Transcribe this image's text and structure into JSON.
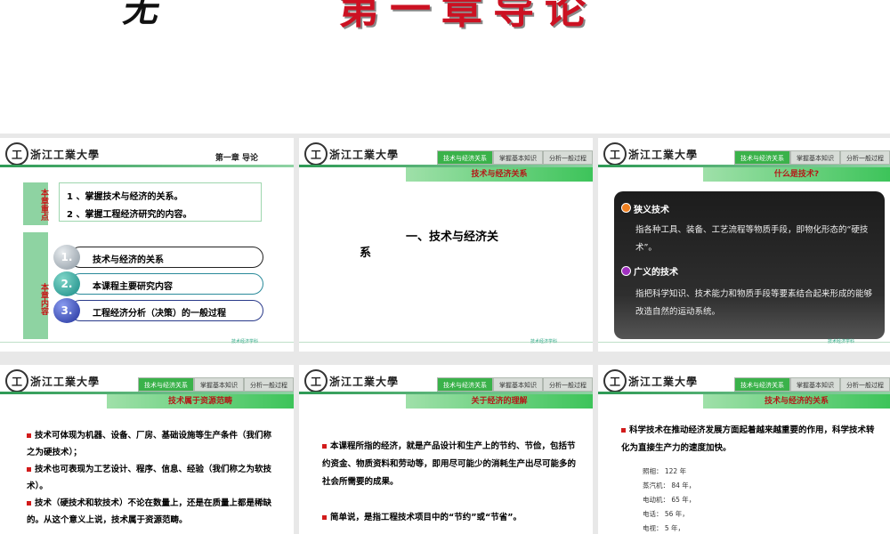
{
  "banner": {
    "left_text": "无",
    "right_text": "第一章导论"
  },
  "school_name": "浙江工業大學",
  "logo_text": "工",
  "footer_text": "技术经济学科",
  "tabs": [
    "技术与经济关系",
    "掌握基本知识",
    "分析一般过程"
  ],
  "slide1": {
    "chapter": "第一章   导论",
    "tag_key": "本章重点",
    "key_points": [
      "1 、掌握技术与经济的关系。",
      "2 、掌握工程经济研究的内容。"
    ],
    "tag_content": "本章内容",
    "items": [
      {
        "num": "1.",
        "text": "技术与经济的关系"
      },
      {
        "num": "2.",
        "text": "本课程主要研究内容"
      },
      {
        "num": "3.",
        "text": "工程经济分析（决策）的一般过程"
      }
    ]
  },
  "slide2": {
    "subhead": "技术与经济关系",
    "title_a": "一、技术与经济关",
    "title_b": "系"
  },
  "slide3": {
    "subhead": "什么是技术?",
    "narrow_title": "狭义技术",
    "narrow_desc": "指各种工具、装备、工艺流程等物质手段，即物化形态的“硬技术”。",
    "broad_title": "广义的技术",
    "broad_desc": "指把科学知识、技术能力和物质手段等要素结合起来形成的能够改造自然的运动系统。"
  },
  "slide4": {
    "subhead": "技术属于资源范畴",
    "paras": [
      "技术可体现为机器、设备、厂房、基础设施等生产条件（我们称之为硬技术）；",
      "技术也可表现为工艺设计、程序、信息、经验（我们称之为软技术）。",
      "技术（硬技术和软技术）不论在数量上，还是在质量上都是稀缺的。从这个意义上说，技术属于资源范畴。"
    ]
  },
  "slide5": {
    "subhead": "关于经济的理解",
    "paras": [
      "本课程所指的经济，就是产品设计和生产上的节约、节俭，包括节约资金、物质资料和劳动等，即用尽可能少的消耗生产出尽可能多的社会所需要的成果。",
      "简单说，是指工程技术项目中的“节约”或“节省”。"
    ]
  },
  "slide6": {
    "subhead": "技术与经济的关系",
    "para": "科学技术在推动经济发展方面起着越来越重要的作用，科学技术转化为直接生产力的速度加快。",
    "list": [
      "照相：   122 年",
      "蒸汽机：  84 年，",
      "电动机：  65 年，",
      "电话：   56 年，",
      "电视：   5 年，"
    ]
  }
}
